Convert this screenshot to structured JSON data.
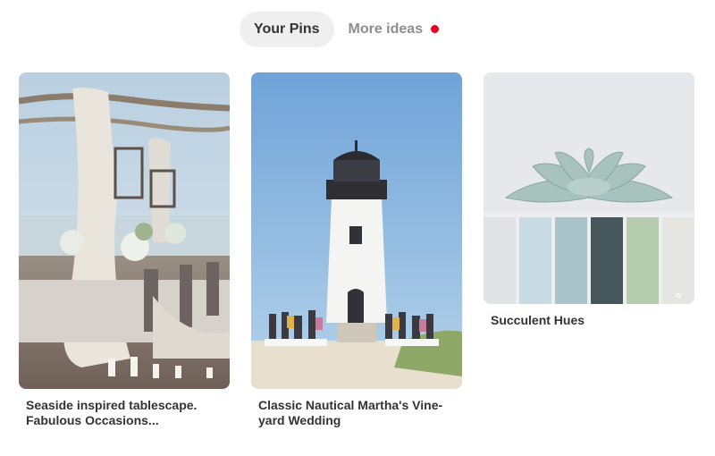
{
  "tabs": [
    {
      "label": "Your Pins",
      "active": true
    },
    {
      "label": "More ideas",
      "active": false,
      "notification_dot": true
    }
  ],
  "colors": {
    "active_tab_bg": "#efefef",
    "notification_dot": "#e60023",
    "title_text": "#333333",
    "inactive_tab_text": "#8e8e8e"
  },
  "pins": [
    {
      "title_line1": "Seaside inspired tablescape.",
      "title_line2": "Fabulous Occasions...",
      "image": "beach wedding tablescape with draped arbor"
    },
    {
      "title_line1": "Classic Nautical Martha's Vine-",
      "title_line2": "yard Wedding",
      "image": "lighthouse wedding ceremony"
    },
    {
      "title_line1": "Succulent Hues",
      "title_line2": "",
      "image": "succulent color palette",
      "palette": [
        "#e0e2e6",
        "#c9dbe2",
        "#a8c3c9",
        "#46585c",
        "#b6ccae",
        "#e5e6e2"
      ]
    }
  ]
}
